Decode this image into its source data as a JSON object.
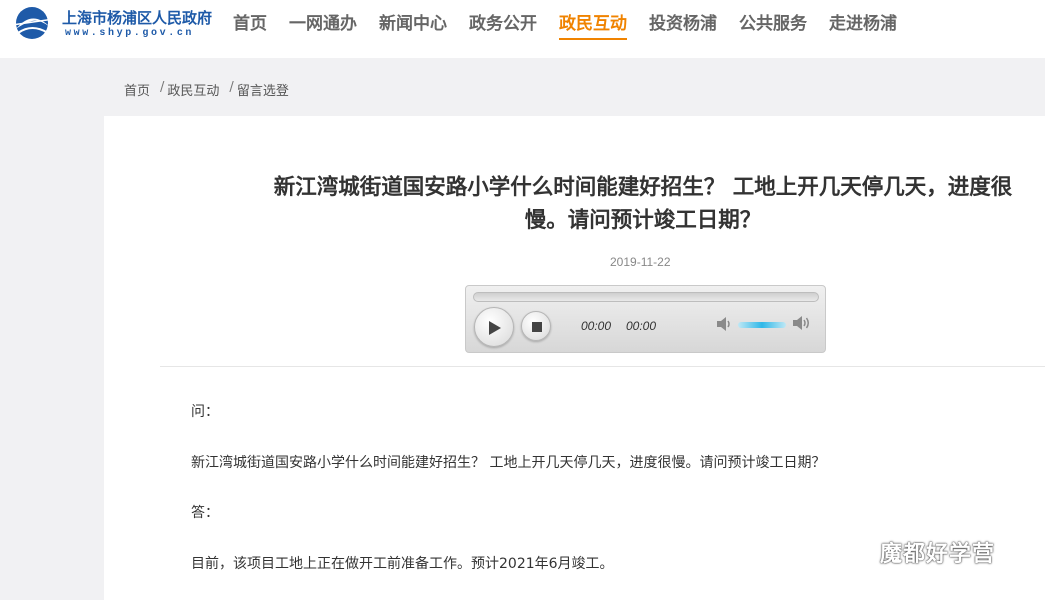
{
  "site": {
    "title": "上海市杨浦区人民政府",
    "url": "www.shyp.gov.cn"
  },
  "nav": [
    {
      "label": "首页",
      "active": false
    },
    {
      "label": "一网通办",
      "active": false
    },
    {
      "label": "新闻中心",
      "active": false
    },
    {
      "label": "政务公开",
      "active": false
    },
    {
      "label": "政民互动",
      "active": true
    },
    {
      "label": "投资杨浦",
      "active": false
    },
    {
      "label": "公共服务",
      "active": false
    },
    {
      "label": "走进杨浦",
      "active": false
    }
  ],
  "breadcrumb": [
    "首页",
    "政民互动",
    "留言选登"
  ],
  "article": {
    "title": "新江湾城街道国安路小学什么时间能建好招生？ 工地上开几天停几天，进度很慢。请问预计竣工日期？",
    "date": "2019-11-22"
  },
  "player": {
    "current_time": "00:00",
    "duration": "00:00",
    "progress": 0,
    "volume": 0.8
  },
  "qa": {
    "question_label": "问：",
    "question_text": "新江湾城街道国安路小学什么时间能建好招生？ 工地上开几天停几天，进度很慢。请问预计竣工日期？",
    "answer_label": "答：",
    "answer_text": "目前，该项目工地上正在做开工前准备工作。预计2021年6月竣工。"
  },
  "watermark": {
    "text": "魔都好学营"
  },
  "colors": {
    "brand_blue": "#1e5aa8",
    "active_orange": "#f08300",
    "page_bg": "#f1f1f3"
  }
}
